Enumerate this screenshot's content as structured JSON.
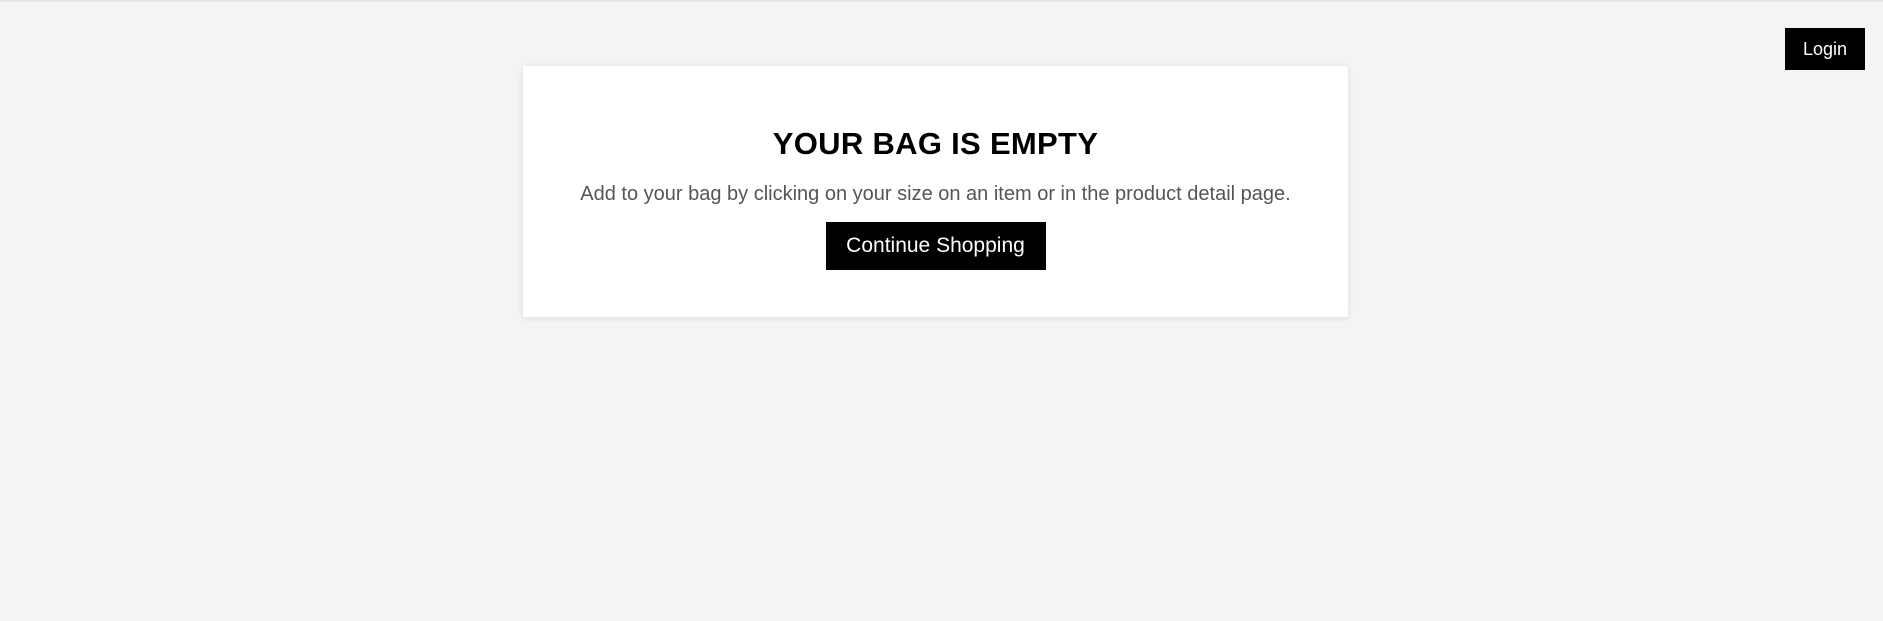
{
  "header": {
    "login_label": "Login"
  },
  "empty_bag": {
    "title": "YOUR BAG IS EMPTY",
    "message": "Add to your bag by clicking on your size on an item or in the product detail page.",
    "continue_label": "Continue Shopping"
  },
  "colors": {
    "page_background": "#f4f4f4",
    "card_background": "#ffffff",
    "button_background": "#000000",
    "button_text": "#ffffff",
    "message_text": "#555555"
  }
}
